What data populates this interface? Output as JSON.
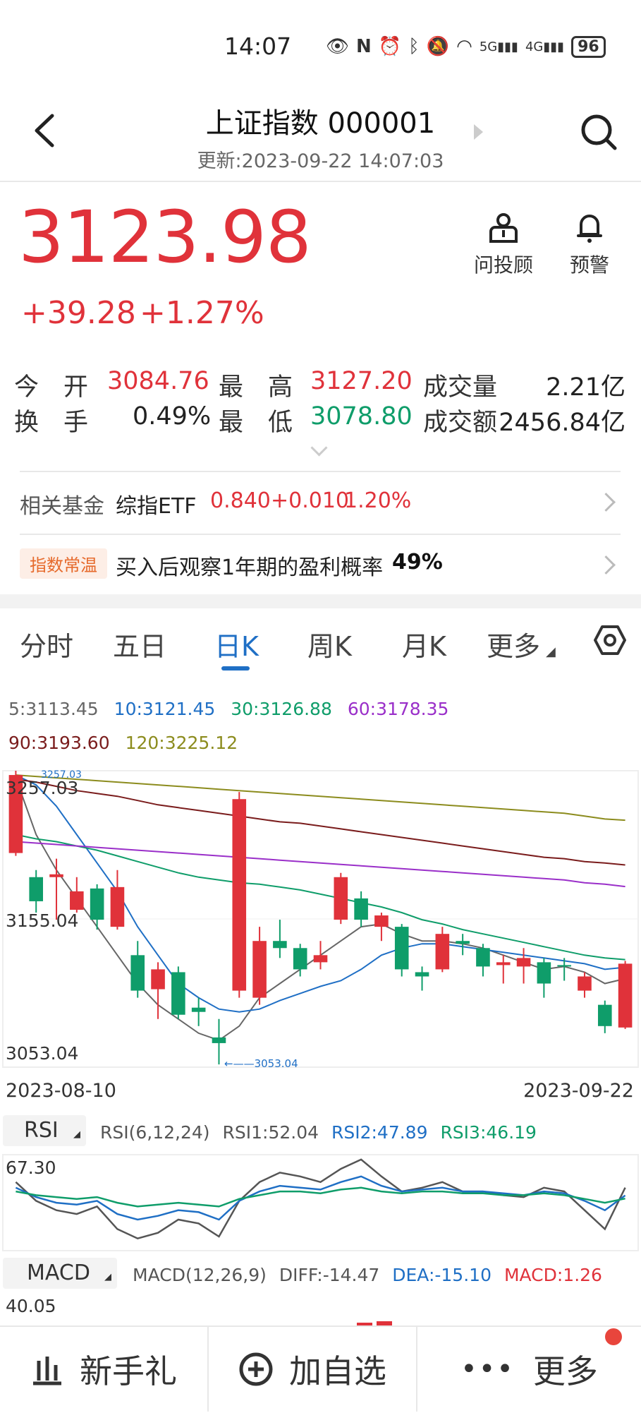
{
  "status_bar": {
    "time": "14:07",
    "battery": "96",
    "net1": "5G",
    "net2": "4G"
  },
  "header": {
    "title": "上证指数 000001",
    "updated": "更新:2023-09-22 14:07:03"
  },
  "quote": {
    "price": "3123.98",
    "change": "+39.28",
    "change_pct": "+1.27%",
    "advisor_label": "问投顾",
    "alert_label": "预警"
  },
  "stats": {
    "open_label": "今　开",
    "open": "3084.76",
    "high_label": "最　高",
    "high": "3127.20",
    "volume_label": "成交量",
    "volume": "2.21亿",
    "turnover_label": "换　手",
    "turnover": "0.49%",
    "low_label": "最　低",
    "low": "3078.80",
    "amount_label": "成交额",
    "amount": "2456.84亿"
  },
  "fund": {
    "label": "相关基金",
    "name": "综指ETF",
    "price": "0.840",
    "change": "+0.010",
    "pct": "1.20%"
  },
  "temp": {
    "badge": "指数常温",
    "text": "买入后观察1年期的盈利概率",
    "prob": "49%"
  },
  "tabs": [
    {
      "label": "分时"
    },
    {
      "label": "五日"
    },
    {
      "label": "日K"
    },
    {
      "label": "周K"
    },
    {
      "label": "月K"
    },
    {
      "label": "更多"
    }
  ],
  "ma_legend": {
    "ma5": "5:3113.45",
    "ma10": "10:3121.45",
    "ma30": "30:3126.88",
    "ma60": "60:3178.35",
    "ma90": "90:3193.60",
    "ma120": "120:3225.12",
    "colors": {
      "ma5": "#666666",
      "ma10": "#1f6fc5",
      "ma30": "#0f9d6a",
      "ma60": "#9a2fc9",
      "ma90": "#7a1c1c",
      "ma120": "#8c8c1e"
    }
  },
  "kline_axis": {
    "top": "3257.03",
    "top_small": "3257.03",
    "mid": "3155.04",
    "bottom": "3053.04",
    "low_marker": "3053.04",
    "start_date": "2023-08-10",
    "end_date": "2023-09-22"
  },
  "rsi": {
    "selector": "RSI",
    "params": "RSI(6,12,24)",
    "rsi1": "RSI1:52.04",
    "rsi2": "RSI2:47.89",
    "rsi3": "RSI3:46.19",
    "top": "67.30"
  },
  "macd": {
    "selector": "MACD",
    "params": "MACD(12,26,9)",
    "diff": "DIFF:-14.47",
    "dea": "DEA:-15.10",
    "macd": "MACD:1.26",
    "top": "40.05"
  },
  "bottom_bar": {
    "gift": "新手礼",
    "add": "加自选",
    "more": "更多"
  },
  "chart_data": {
    "type": "candlestick",
    "x_start": "2023-08-10",
    "x_end": "2023-09-22",
    "ylim": [
      3053.04,
      3257.03
    ],
    "candles": [
      {
        "o": 3202,
        "c": 3257,
        "h": 3260,
        "l": 3200
      },
      {
        "o": 3185,
        "c": 3168,
        "h": 3190,
        "l": 3160
      },
      {
        "o": 3185,
        "c": 3187,
        "h": 3198,
        "l": 3155
      },
      {
        "o": 3162,
        "c": 3175,
        "h": 3185,
        "l": 3160
      },
      {
        "o": 3177,
        "c": 3155,
        "h": 3180,
        "l": 3148
      },
      {
        "o": 3150,
        "c": 3178,
        "h": 3190,
        "l": 3148
      },
      {
        "o": 3130,
        "c": 3105,
        "h": 3140,
        "l": 3100
      },
      {
        "o": 3106,
        "c": 3120,
        "h": 3125,
        "l": 3085
      },
      {
        "o": 3118,
        "c": 3088,
        "h": 3122,
        "l": 3085
      },
      {
        "o": 3093,
        "c": 3090,
        "h": 3100,
        "l": 3080
      },
      {
        "o": 3072,
        "c": 3068,
        "h": 3085,
        "l": 3053
      },
      {
        "o": 3105,
        "c": 3240,
        "h": 3245,
        "l": 3100
      },
      {
        "o": 3100,
        "c": 3140,
        "h": 3150,
        "l": 3095
      },
      {
        "o": 3140,
        "c": 3135,
        "h": 3155,
        "l": 3128
      },
      {
        "o": 3135,
        "c": 3120,
        "h": 3138,
        "l": 3115
      },
      {
        "o": 3125,
        "c": 3130,
        "h": 3140,
        "l": 3120
      },
      {
        "o": 3155,
        "c": 3185,
        "h": 3188,
        "l": 3152
      },
      {
        "o": 3170,
        "c": 3155,
        "h": 3175,
        "l": 3150
      },
      {
        "o": 3150,
        "c": 3158,
        "h": 3160,
        "l": 3140
      },
      {
        "o": 3150,
        "c": 3120,
        "h": 3152,
        "l": 3115
      },
      {
        "o": 3118,
        "c": 3115,
        "h": 3122,
        "l": 3105
      },
      {
        "o": 3120,
        "c": 3145,
        "h": 3150,
        "l": 3118
      },
      {
        "o": 3140,
        "c": 3138,
        "h": 3145,
        "l": 3130
      },
      {
        "o": 3135,
        "c": 3122,
        "h": 3138,
        "l": 3115
      },
      {
        "o": 3123,
        "c": 3125,
        "h": 3130,
        "l": 3110
      },
      {
        "o": 3122,
        "c": 3128,
        "h": 3135,
        "l": 3110
      },
      {
        "o": 3125,
        "c": 3110,
        "h": 3128,
        "l": 3100
      },
      {
        "o": 3123,
        "c": 3122,
        "h": 3128,
        "l": 3112
      },
      {
        "o": 3105,
        "c": 3115,
        "h": 3118,
        "l": 3100
      },
      {
        "o": 3095,
        "c": 3080,
        "h": 3098,
        "l": 3075
      },
      {
        "o": 3079,
        "c": 3124,
        "h": 3126,
        "l": 3078
      }
    ],
    "ma_lines": {
      "ma5": [
        3255,
        3215,
        3190,
        3170,
        3150,
        3130,
        3110,
        3095,
        3085,
        3075,
        3070,
        3080,
        3100,
        3110,
        3120,
        3130,
        3140,
        3150,
        3152,
        3145,
        3140,
        3140,
        3138,
        3135,
        3130,
        3125,
        3120,
        3122,
        3118,
        3110,
        3113.45
      ],
      "ma10": [
        3257,
        3250,
        3235,
        3215,
        3195,
        3175,
        3150,
        3130,
        3110,
        3100,
        3092,
        3090,
        3092,
        3098,
        3103,
        3108,
        3112,
        3120,
        3130,
        3135,
        3138,
        3138,
        3136,
        3134,
        3132,
        3130,
        3128,
        3126,
        3124,
        3120,
        3121.45
      ],
      "ma30": [
        3215,
        3212,
        3210,
        3207,
        3204,
        3200,
        3196,
        3192,
        3188,
        3185,
        3183,
        3181,
        3180,
        3178,
        3176,
        3173,
        3170,
        3167,
        3164,
        3160,
        3155,
        3152,
        3148,
        3145,
        3142,
        3139,
        3136,
        3133,
        3130,
        3128,
        3126.88
      ],
      "ma60": [
        3210,
        3209,
        3208,
        3207,
        3206,
        3205,
        3204,
        3203,
        3202,
        3201,
        3200,
        3199,
        3198,
        3197,
        3196,
        3195,
        3194,
        3193,
        3192,
        3191,
        3190,
        3189,
        3188,
        3187,
        3186,
        3185,
        3184,
        3183,
        3181,
        3180,
        3178.35
      ],
      "ma90": [
        3254,
        3252,
        3249,
        3246,
        3244,
        3242,
        3239,
        3236,
        3234,
        3232,
        3230,
        3228,
        3226,
        3224,
        3223,
        3221,
        3219,
        3217,
        3215,
        3213,
        3211,
        3209,
        3207,
        3205,
        3203,
        3201,
        3199,
        3198,
        3196,
        3195,
        3193.6
      ],
      "ma120": [
        3257,
        3256,
        3255,
        3254,
        3253,
        3252,
        3251,
        3250,
        3249,
        3248,
        3247,
        3246,
        3245,
        3244,
        3243,
        3242,
        3241,
        3240,
        3239,
        3238,
        3237,
        3236,
        3235,
        3234,
        3233,
        3232,
        3231,
        3230,
        3228,
        3226,
        3225.12
      ]
    },
    "rsi_ylim": [
      20,
      67.3
    ],
    "rsi_lines": {
      "rsi1": [
        55,
        45,
        40,
        38,
        42,
        30,
        25,
        28,
        35,
        33,
        26,
        45,
        55,
        60,
        58,
        55,
        62,
        67,
        58,
        50,
        52,
        55,
        50,
        50,
        48,
        47,
        52,
        50,
        40,
        30,
        52.04
      ],
      "rsi2": [
        52,
        47,
        44,
        43,
        45,
        38,
        35,
        37,
        40,
        39,
        35,
        45,
        50,
        53,
        52,
        51,
        55,
        58,
        53,
        50,
        51,
        52,
        50,
        50,
        49,
        48,
        50,
        49,
        45,
        40,
        47.89
      ],
      "rsi3": [
        50,
        48,
        47,
        46,
        47,
        44,
        42,
        43,
        44,
        43,
        42,
        46,
        48,
        50,
        50,
        49,
        51,
        52,
        50,
        49,
        50,
        50,
        49,
        49,
        48,
        48,
        49,
        48,
        46,
        44,
        46.19
      ]
    }
  }
}
